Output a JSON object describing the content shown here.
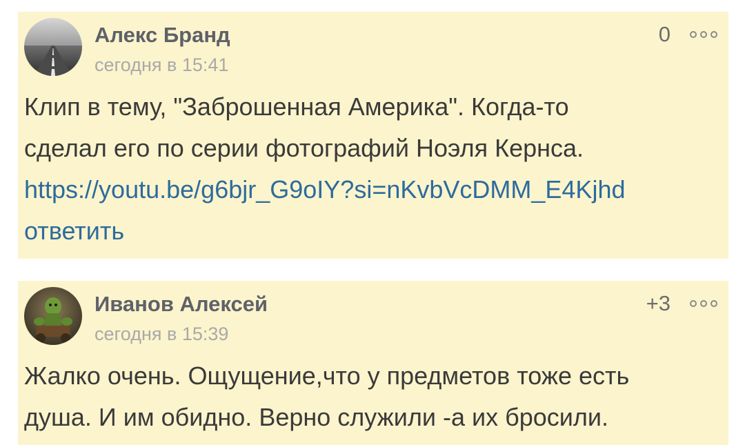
{
  "comments": [
    {
      "author": "Алекс Бранд",
      "time": "сегодня в 15:41",
      "rating": "0",
      "text_lines": [
        "Клип в тему, \"Заброшенная Америка\". Когда-то",
        "сделал его по серии фотографий Ноэля Кернса."
      ],
      "link": "https://youtu.be/g6bjr_G9oIY?si=nKvbVcDMM_E4Kjhd",
      "reply_label": "ответить",
      "avatar": "road-avatar",
      "more_icon": "more-options-icon"
    },
    {
      "author": "Иванов Алексей",
      "time": "сегодня в 15:39",
      "rating": "+3",
      "text_lines": [
        "Жалко очень. Ощущение,что у предметов тоже есть",
        "душа. И им обидно. Верно служили -а их бросили."
      ],
      "avatar": "character-avatar",
      "more_icon": "more-options-icon"
    }
  ],
  "colors": {
    "card_background": "#fcf4cc",
    "author": "#5f6169",
    "timestamp": "#a9a9a9",
    "body_text": "#3a3a3a",
    "link": "#2c6b9e"
  }
}
